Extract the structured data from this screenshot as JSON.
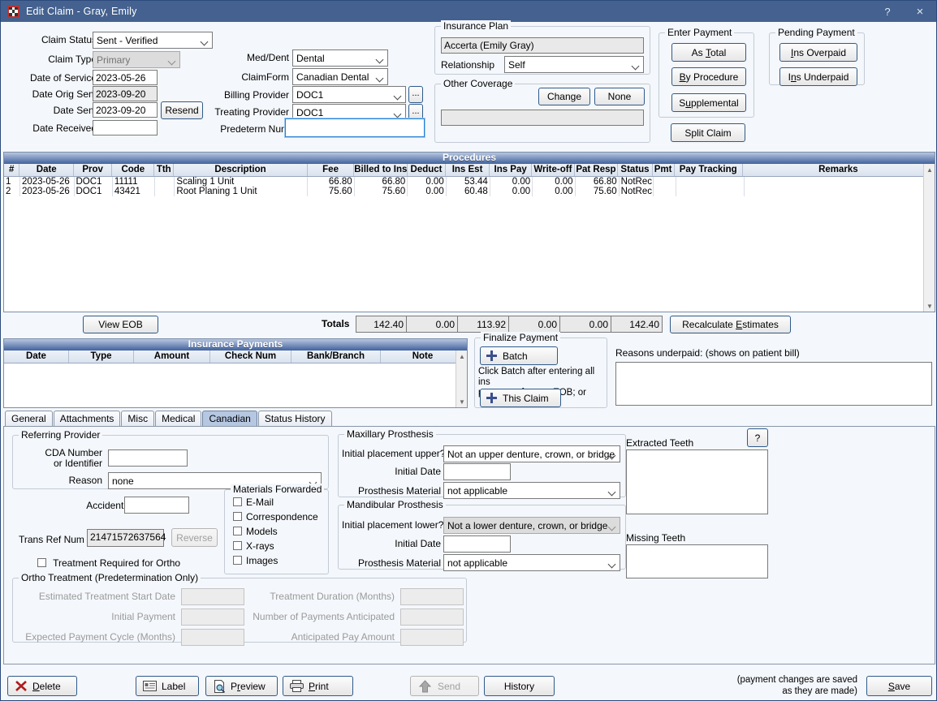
{
  "window": {
    "title": "Edit Claim - Gray, Emily",
    "help_label": "?",
    "close_label": "×",
    "icon": "app-grid-icon"
  },
  "claim": {
    "status_label": "Claim Status",
    "status_value": "Sent - Verified",
    "type_label": "Claim Type",
    "type_value": "Primary",
    "date_service_label": "Date of Service",
    "date_service_value": "2023-05-26",
    "date_orig_sent_label": "Date Orig Sent",
    "date_orig_sent_value": "2023-09-20",
    "date_sent_label": "Date Sent",
    "date_sent_value": "2023-09-20",
    "resend_label": "Resend",
    "date_received_label": "Date Received",
    "date_received_value": ""
  },
  "form": {
    "meddent_label": "Med/Dent",
    "meddent_value": "Dental",
    "claimform_label": "ClaimForm",
    "claimform_value": "Canadian Dental",
    "billing_provider_label": "Billing Provider",
    "billing_provider_value": "DOC1",
    "treating_provider_label": "Treating Provider",
    "treating_provider_value": "DOC1",
    "predeterm_label": "Predeterm Num",
    "predeterm_value": "",
    "ellipsis_label": "..."
  },
  "insurance_plan": {
    "caption": "Insurance Plan",
    "plan_value": "Accerta (Emily Gray)",
    "relationship_label": "Relationship",
    "relationship_value": "Self"
  },
  "other_coverage": {
    "caption": "Other Coverage",
    "change_label": "Change",
    "none_label": "None",
    "value": ""
  },
  "enter_payment": {
    "caption": "Enter Payment",
    "as_total_label": "As Total",
    "by_procedure_label": "By Procedure",
    "supplemental_label": "Supplemental",
    "split_claim_label": "Split Claim"
  },
  "pending_payment": {
    "caption": "Pending Payment",
    "ins_overpaid_label": "Ins Overpaid",
    "ins_underpaid_label": "Ins Underpaid"
  },
  "procedures": {
    "title": "Procedures",
    "columns": [
      "#",
      "Date",
      "Prov",
      "Code",
      "Tth",
      "Description",
      "Fee",
      "Billed to Ins",
      "Deduct",
      "Ins Est",
      "Ins Pay",
      "Write-off",
      "Pat Resp",
      "Status",
      "Pmt",
      "Pay Tracking",
      "Remarks"
    ],
    "rows": [
      {
        "num": "1",
        "date": "2023-05-26",
        "prov": "DOC1",
        "code": "11111",
        "tth": "",
        "description": "Scaling 1 Unit",
        "fee": "66.80",
        "billed": "66.80",
        "deduct": "0.00",
        "ins_est": "53.44",
        "ins_pay": "0.00",
        "write_off": "0.00",
        "pat_resp": "66.80",
        "status": "NotRec",
        "pmt": "",
        "pay_tracking": "",
        "remarks": ""
      },
      {
        "num": "2",
        "date": "2023-05-26",
        "prov": "DOC1",
        "code": "43421",
        "tth": "",
        "description": "Root Planing 1 Unit",
        "fee": "75.60",
        "billed": "75.60",
        "deduct": "0.00",
        "ins_est": "60.48",
        "ins_pay": "0.00",
        "write_off": "0.00",
        "pat_resp": "75.60",
        "status": "NotRec",
        "pmt": "",
        "pay_tracking": "",
        "remarks": ""
      }
    ]
  },
  "totals": {
    "view_eob_label": "View EOB",
    "label": "Totals",
    "values": [
      "142.40",
      "0.00",
      "113.92",
      "0.00",
      "0.00",
      "142.40"
    ],
    "recalculate_label": "Recalculate Estimates"
  },
  "insurance_payments": {
    "title": "Insurance Payments",
    "columns": [
      "Date",
      "Type",
      "Amount",
      "Check Num",
      "Bank/Branch",
      "Note"
    ],
    "rows": []
  },
  "finalize_payment": {
    "caption": "Finalize Payment",
    "batch_label": "Batch",
    "hint_line1": "Click Batch after entering all ins",
    "hint_line2": "payments for one EOB; or",
    "this_claim_label": "This Claim"
  },
  "reasons_underpaid": {
    "label": "Reasons underpaid:  (shows on patient bill)",
    "value": ""
  },
  "tabs": [
    {
      "label": "General",
      "active": false
    },
    {
      "label": "Attachments",
      "active": false
    },
    {
      "label": "Misc",
      "active": false
    },
    {
      "label": "Medical",
      "active": false
    },
    {
      "label": "Canadian",
      "active": true
    },
    {
      "label": "Status History",
      "active": false
    }
  ],
  "referring_provider": {
    "caption": "Referring Provider",
    "cda_label_line1": "CDA Number",
    "cda_label_line2": "or Identifier",
    "cda_value": "",
    "reason_label": "Reason",
    "reason_value": "none"
  },
  "accident": {
    "date_label": "Accident Date",
    "date_value": "",
    "trans_ref_label": "Trans Ref Num",
    "trans_ref_value": "21471572637564",
    "reverse_label": "Reverse",
    "ortho_required_label": "Treatment Required for Ortho",
    "ortho_required_checked": false
  },
  "materials_forwarded": {
    "caption": "Materials Forwarded",
    "items": [
      {
        "label": "E-Mail",
        "checked": false
      },
      {
        "label": "Correspondence",
        "checked": false
      },
      {
        "label": "Models",
        "checked": false
      },
      {
        "label": "X-rays",
        "checked": false
      },
      {
        "label": "Images",
        "checked": false
      }
    ]
  },
  "maxillary": {
    "caption": "Maxillary Prosthesis",
    "placement_label": "Initial placement upper?",
    "placement_value": "Not an upper denture, crown, or bridge",
    "initial_date_label": "Initial Date",
    "initial_date_value": "",
    "material_label": "Prosthesis Material",
    "material_value": "not applicable"
  },
  "mandibular": {
    "caption": "Mandibular Prosthesis",
    "placement_label": "Initial placement lower?",
    "placement_value": "Not a lower denture, crown, or bridge",
    "initial_date_label": "Initial Date",
    "initial_date_value": "",
    "material_label": "Prosthesis Material",
    "material_value": "not applicable"
  },
  "teeth": {
    "help_label": "?",
    "extracted_label": "Extracted Teeth",
    "extracted_value": "",
    "missing_label": "Missing Teeth",
    "missing_value": ""
  },
  "ortho": {
    "caption": "Ortho Treatment (Predetermination Only)",
    "start_date_label": "Estimated Treatment Start Date",
    "start_date_value": "",
    "initial_payment_label": "Initial Payment",
    "initial_payment_value": "",
    "payment_cycle_label": "Expected Payment Cycle (Months)",
    "payment_cycle_value": "",
    "duration_label": "Treatment Duration (Months)",
    "duration_value": "",
    "num_payments_label": "Number of Payments Anticipated",
    "num_payments_value": "",
    "anticipated_pay_label": "Anticipated Pay Amount",
    "anticipated_pay_value": ""
  },
  "footer": {
    "delete_label": "Delete",
    "label_label": "Label",
    "preview_label": "Preview",
    "print_label": "Print",
    "send_label": "Send",
    "history_label": "History",
    "note_line1": "(payment changes are saved",
    "note_line2": "as they are made)",
    "save_label": "Save"
  }
}
